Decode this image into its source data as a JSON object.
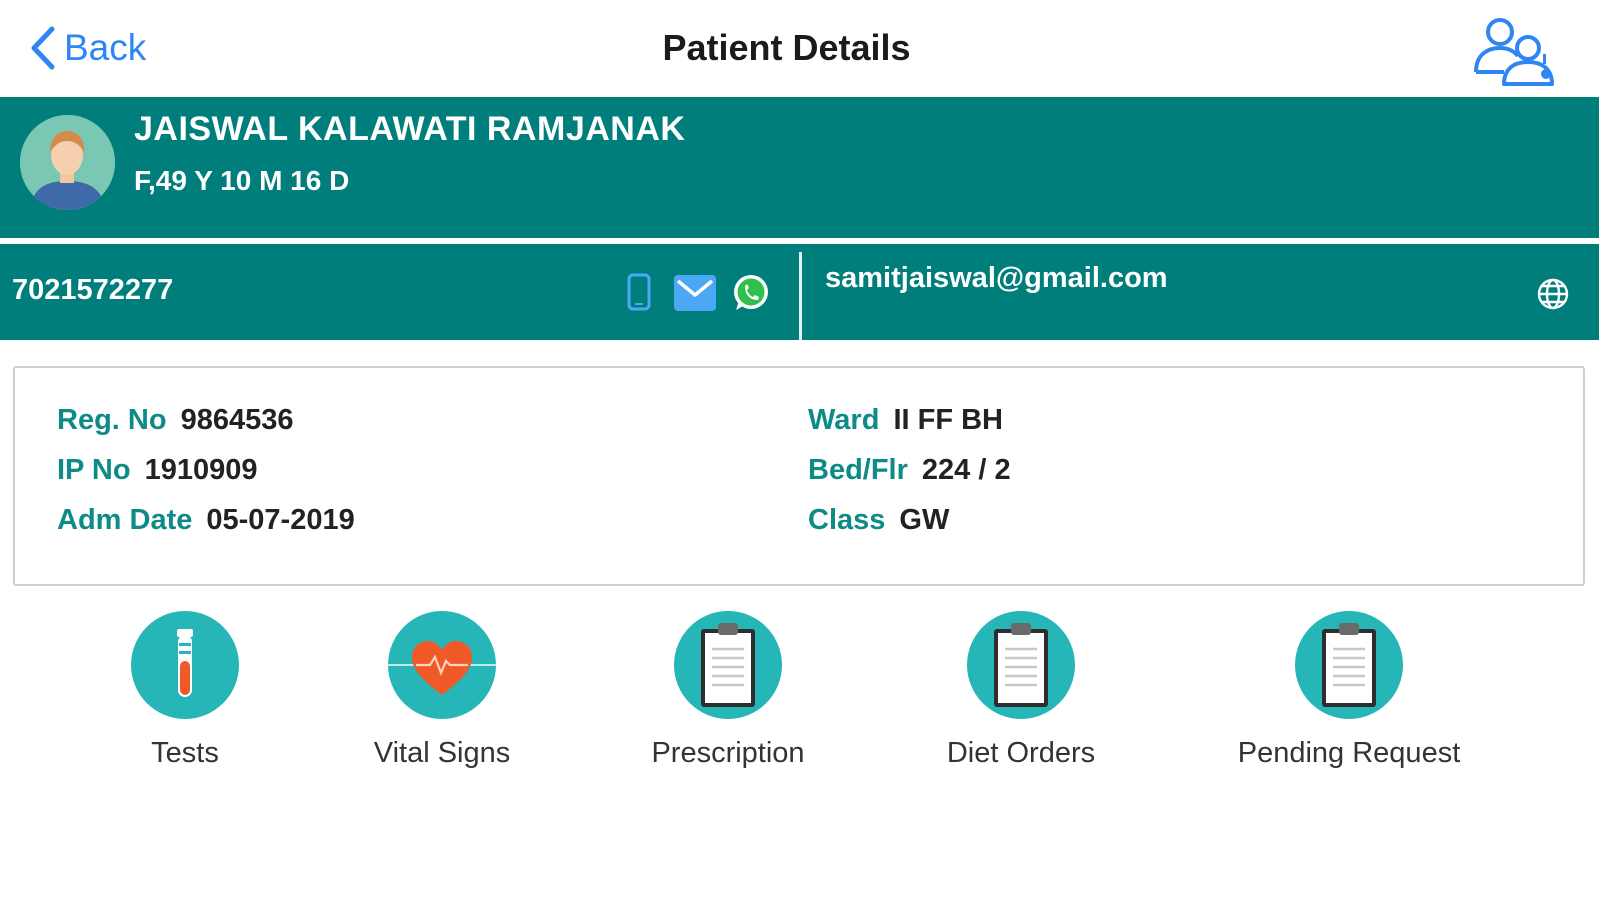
{
  "nav": {
    "back_label": "Back",
    "title": "Patient Details",
    "users_icon": "users-group-icon",
    "accent": "#2f86f3"
  },
  "patient": {
    "name": "JAISWAL KALAWATI RAMJANAK",
    "demographics": "F,49 Y 10 M 16 D",
    "avatar_icon": "patient-avatar-icon"
  },
  "contact": {
    "phone": "7021572277",
    "email": "samitjaiswal@gmail.com",
    "icons": [
      "mobile-icon",
      "mail-icon",
      "whatsapp-icon",
      "globe-icon"
    ]
  },
  "details": {
    "reg_no_label": "Reg. No",
    "reg_no": "9864536",
    "ip_no_label": "IP No",
    "ip_no": "1910909",
    "adm_date_label": "Adm Date",
    "adm_date": "05-07-2019",
    "ward_label": "Ward",
    "ward": "II FF BH",
    "bed_label": "Bed/Flr",
    "bed": "224 / 2",
    "class_label": "Class",
    "class": "GW"
  },
  "actions": [
    {
      "label": "Tests",
      "icon": "test-tube-icon"
    },
    {
      "label": "Vital Signs",
      "icon": "heart-pulse-icon"
    },
    {
      "label": "Prescription",
      "icon": "clipboard-icon"
    },
    {
      "label": "Diet Orders",
      "icon": "clipboard-icon"
    },
    {
      "label": "Pending Request",
      "icon": "clipboard-icon"
    }
  ],
  "colors": {
    "header_bg": "#007e7b",
    "label_teal": "#0e8b86",
    "action_circle": "#26b6b8"
  }
}
